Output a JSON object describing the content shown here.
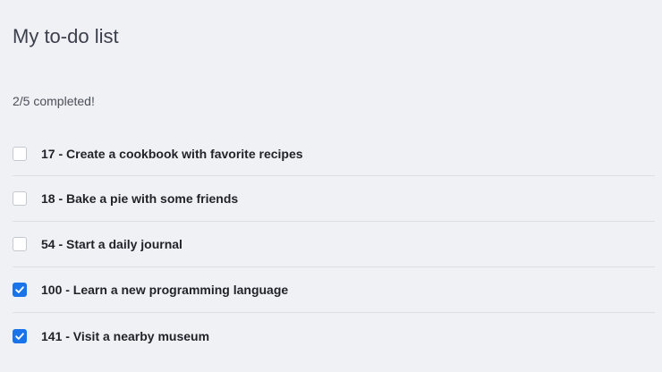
{
  "header": {
    "title": "My to-do list"
  },
  "progress": {
    "text": "2/5 completed!"
  },
  "colors": {
    "accent": "#1a73e8",
    "background": "#f0f1f4"
  },
  "todos": [
    {
      "label": "17 - Create a cookbook with favorite recipes",
      "checked": false
    },
    {
      "label": "18 - Bake a pie with some friends",
      "checked": false
    },
    {
      "label": "54 - Start a daily journal",
      "checked": false
    },
    {
      "label": "100 - Learn a new programming language",
      "checked": true
    },
    {
      "label": "141 - Visit a nearby museum",
      "checked": true
    }
  ]
}
